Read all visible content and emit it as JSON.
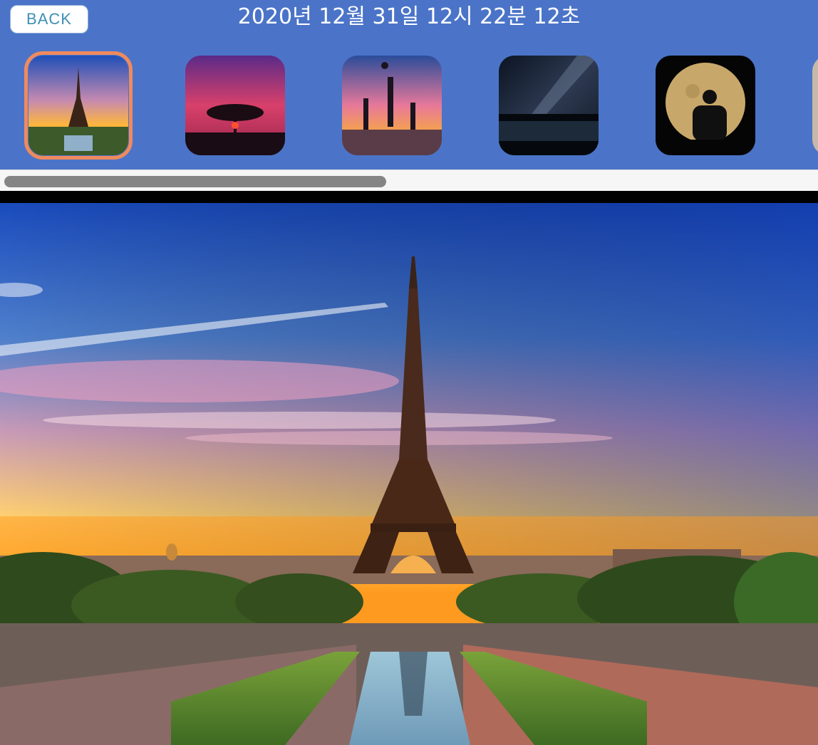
{
  "header": {
    "back_label": "BACK",
    "title": "2020년 12월 31일 12시 22분 12초",
    "background_color": "#4b74c8",
    "selected_border_color": "#f08a5d"
  },
  "thumbnails": [
    {
      "subject": "eiffel-tower-sunset",
      "selected": true
    },
    {
      "subject": "tree-red-clouds",
      "selected": false
    },
    {
      "subject": "silhouettes-basketball",
      "selected": false
    },
    {
      "subject": "milky-way-lake",
      "selected": false
    },
    {
      "subject": "moon-silhouette",
      "selected": false
    },
    {
      "subject": "partial-thumbnail",
      "selected": false
    }
  ],
  "scrollbar": {
    "position_fraction": 0.0,
    "visible_fraction": 0.47
  },
  "main_image": {
    "subject": "eiffel-tower-sunset"
  }
}
